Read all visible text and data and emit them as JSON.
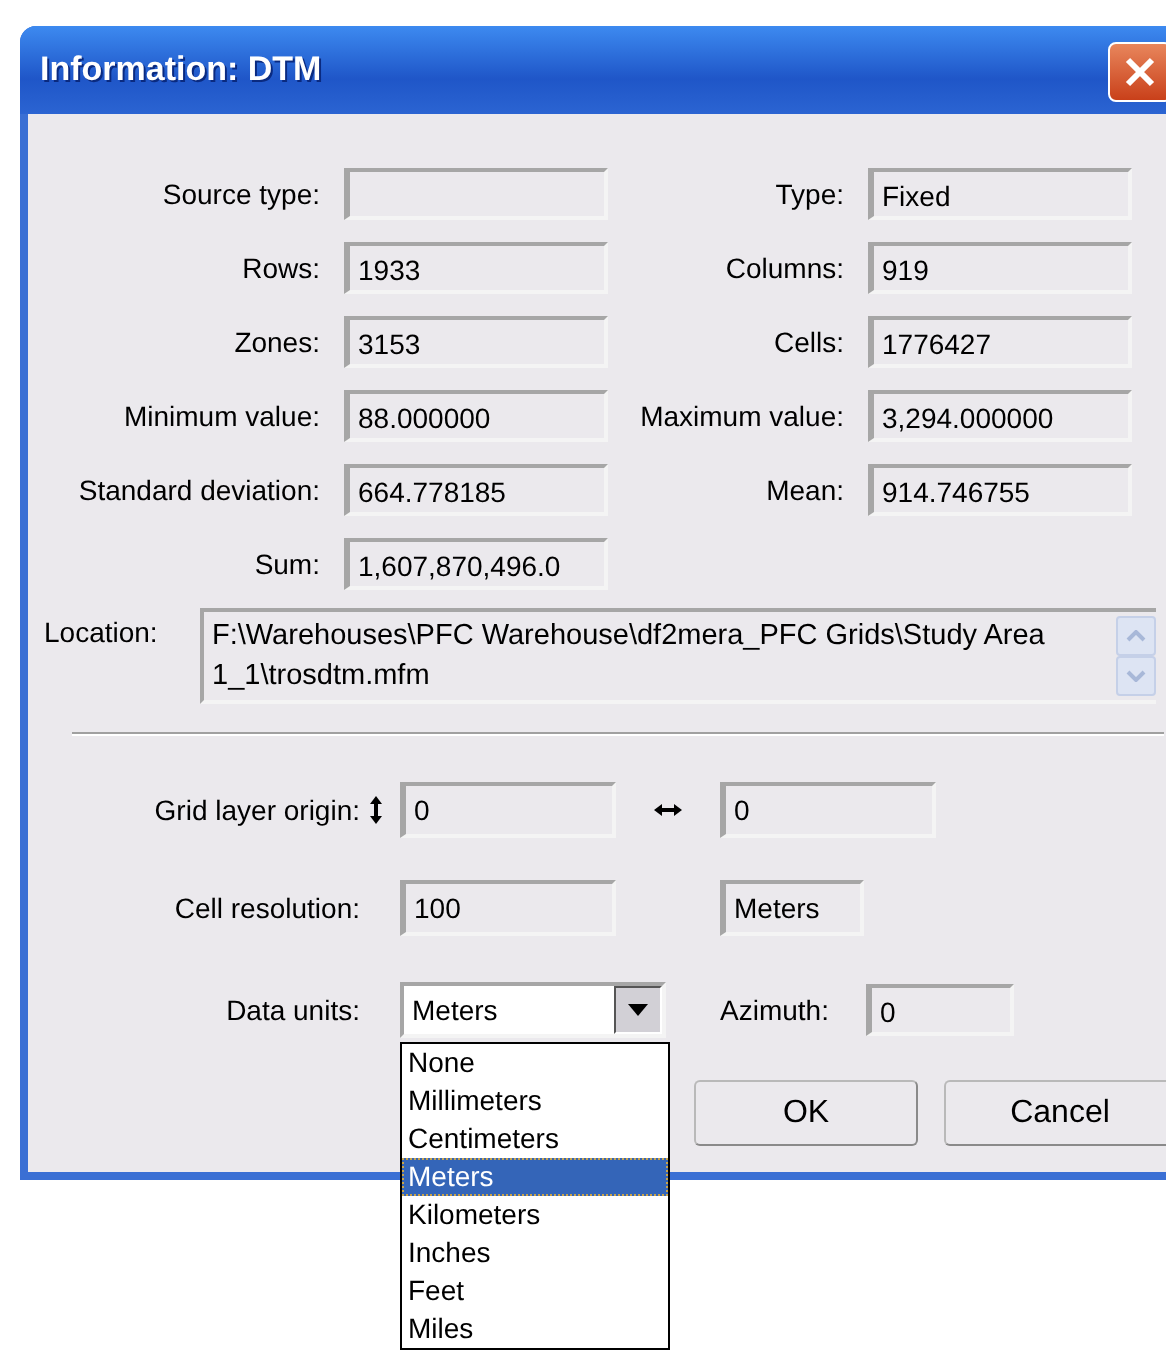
{
  "window": {
    "title": "Information: DTM"
  },
  "info_rows": [
    {
      "left": {
        "label": "Source type:"
      },
      "right": {
        "label": "Type:",
        "value": "Fixed"
      }
    },
    {
      "left": {
        "label": "Rows:",
        "value": "1933"
      },
      "right": {
        "label": "Columns:",
        "value": "919"
      }
    },
    {
      "left": {
        "label": "Zones:",
        "value": "3153"
      },
      "right": {
        "label": "Cells:",
        "value": "1776427"
      }
    },
    {
      "left": {
        "label": "Minimum value:",
        "value": "88.000000"
      },
      "right": {
        "label": "Maximum value:",
        "value": "3,294.000000"
      }
    },
    {
      "left": {
        "label": "Standard deviation:",
        "value": "664.778185"
      },
      "right": {
        "label": "Mean:",
        "value": "914.746755"
      }
    },
    {
      "left": {
        "label": "Sum:",
        "value": "1,607,870,496.0"
      }
    }
  ],
  "location": {
    "label": "Location:",
    "value": "F:\\Warehouses\\PFC Warehouse\\df2mera_PFC Grids\\Study Area 1_1\\trosdtm.mfm"
  },
  "grid_origin": {
    "label": "Grid layer origin:",
    "vertical": "0",
    "horizontal": "0"
  },
  "cell_resolution": {
    "label": "Cell resolution:",
    "value": "100",
    "units": "Meters"
  },
  "data_units": {
    "label": "Data units:",
    "value": "Meters",
    "expanded": true,
    "options": [
      {
        "label": "None",
        "selected": false
      },
      {
        "label": "Millimeters",
        "selected": false
      },
      {
        "label": "Centimeters",
        "selected": false
      },
      {
        "label": "Meters",
        "selected": true
      },
      {
        "label": "Kilometers",
        "selected": false
      },
      {
        "label": "Inches",
        "selected": false
      },
      {
        "label": "Feet",
        "selected": false
      },
      {
        "label": "Miles",
        "selected": false
      }
    ]
  },
  "azimuth": {
    "label": "Azimuth:",
    "value": "0"
  },
  "buttons": [
    "OK",
    "Cancel"
  ]
}
